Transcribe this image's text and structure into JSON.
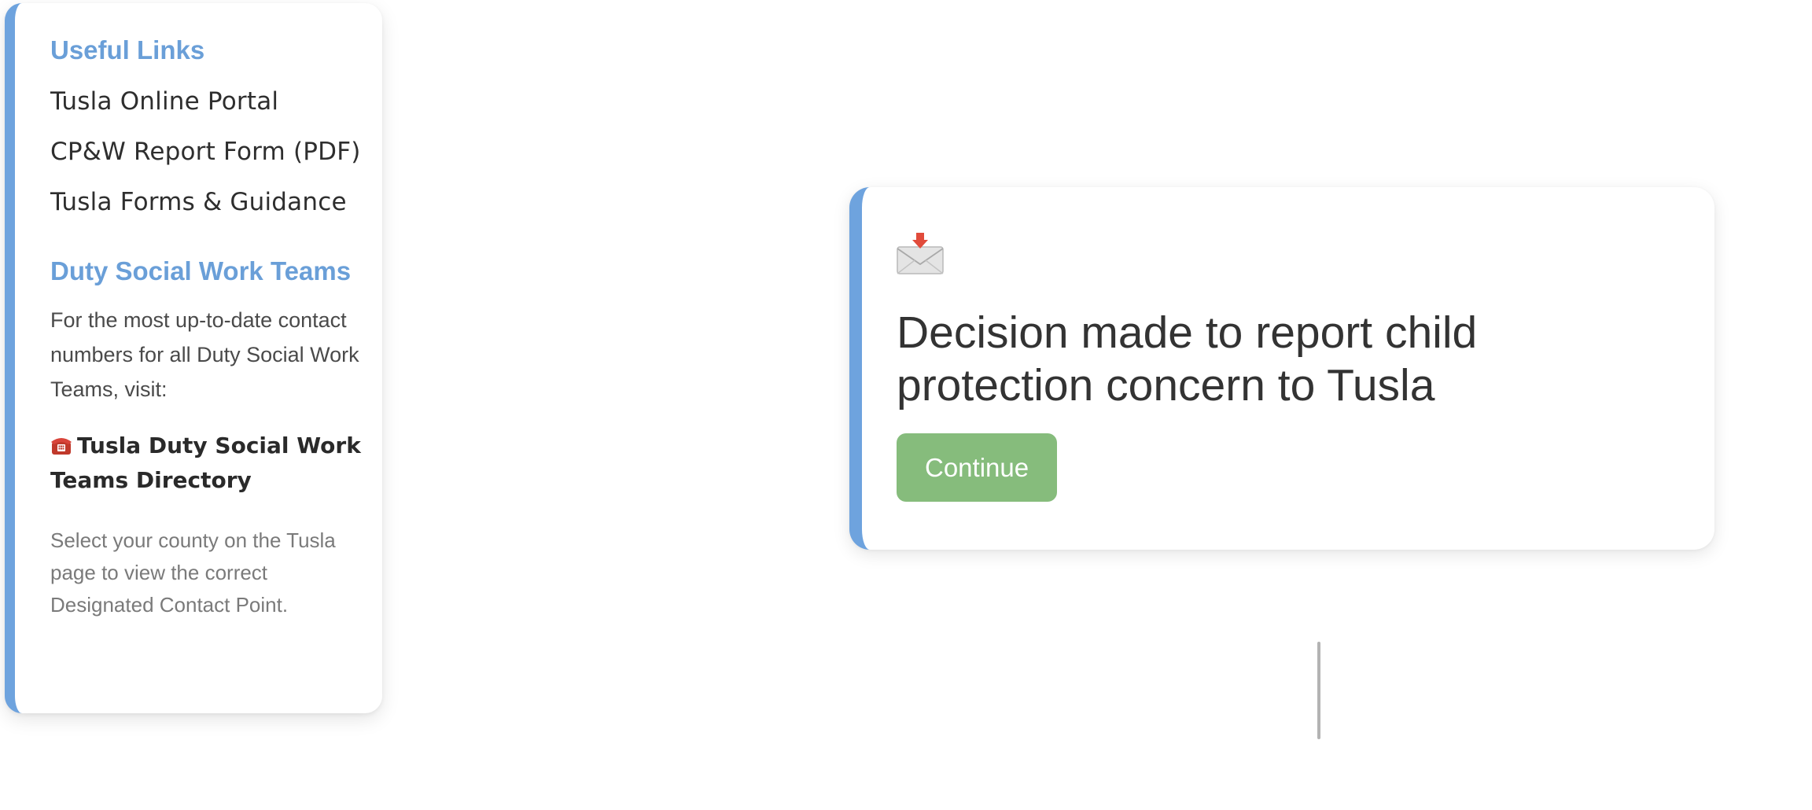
{
  "sidebar": {
    "useful_links_title": "Useful Links",
    "links": [
      {
        "label": "Tusla Online Portal"
      },
      {
        "label": "CP&W Report Form (PDF)"
      },
      {
        "label": "Tusla Forms & Guidance"
      }
    ],
    "duty_title": "Duty Social Work Teams",
    "duty_text": "For the most up-to-date contact numbers for all Duty Social Work Teams, visit:",
    "directory_icon": "telephone-icon",
    "directory_link": "Tusla Duty Social Work Teams Directory",
    "note": "Select your county on the Tusla page to view the correct Designated Contact Point."
  },
  "card": {
    "icon": "envelope-with-arrow-icon",
    "title": "Decision made to report child protection concern to Tusla",
    "continue_label": "Continue"
  },
  "colors": {
    "accent_blue": "#6ea3de",
    "heading_blue": "#6a9fd8",
    "button_green": "#86bc7c",
    "connector_gray": "#b3b3b3"
  }
}
